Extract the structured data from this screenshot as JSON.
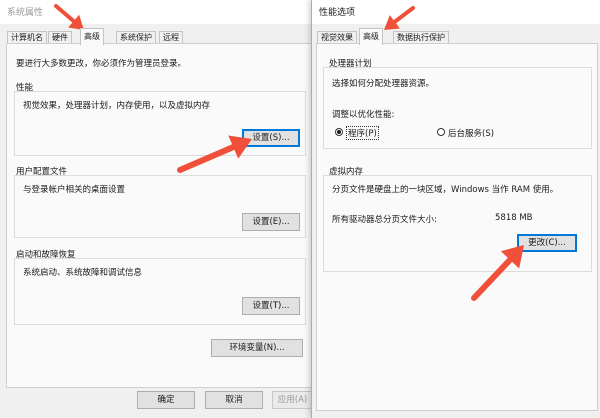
{
  "system_props": {
    "title": "系统属性",
    "tabs": [
      "计算机名",
      "硬件",
      "高级",
      "系统保护",
      "远程"
    ],
    "notice": "要进行大多数更改，你必须作为管理员登录。",
    "performance": {
      "label": "性能",
      "desc": "视觉效果，处理器计划，内存使用，以及虚拟内存",
      "button": "设置(S)..."
    },
    "user_profile": {
      "label": "用户配置文件",
      "desc": "与登录帐户相关的桌面设置",
      "button": "设置(E)..."
    },
    "startup": {
      "label": "启动和故障恢复",
      "desc": "系统启动、系统故障和调试信息",
      "button": "设置(T)..."
    },
    "env_button": "环境变量(N)...",
    "footer": {
      "ok": "确定",
      "cancel": "取消",
      "apply": "应用(A)"
    }
  },
  "perf_options": {
    "title": "性能选项",
    "tabs": [
      "视觉效果",
      "高级",
      "数据执行保护"
    ],
    "processor": {
      "label": "处理器计划",
      "desc": "选择如何分配处理器资源。",
      "adjust_label": "调整以优化性能:",
      "opt_programs": "程序(P)",
      "opt_background": "后台服务(S)",
      "selected": "程序(P)"
    },
    "virtual_memory": {
      "label": "虚拟内存",
      "desc": "分页文件是硬盘上的一块区域，Windows 当作 RAM 使用。",
      "total_label": "所有驱动器总分页文件大小:",
      "total_value": "5818 MB",
      "change_button": "更改(C)..."
    }
  },
  "colors": {
    "annotation_arrow": "#f0503a",
    "focus": "#0078d7"
  }
}
